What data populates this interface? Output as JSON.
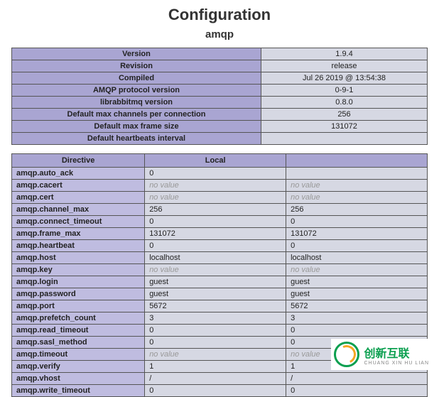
{
  "header": {
    "title": "Configuration",
    "subtitle": "amqp"
  },
  "info": [
    {
      "label": "Version",
      "value": "1.9.4"
    },
    {
      "label": "Revision",
      "value": "release"
    },
    {
      "label": "Compiled",
      "value": "Jul 26 2019 @ 13:54:38"
    },
    {
      "label": "AMQP protocol version",
      "value": "0-9-1"
    },
    {
      "label": "librabbitmq version",
      "value": "0.8.0"
    },
    {
      "label": "Default max channels per connection",
      "value": "256"
    },
    {
      "label": "Default max frame size",
      "value": "131072"
    },
    {
      "label": "Default heartbeats interval",
      "value": ""
    }
  ],
  "dir_headers": {
    "directive": "Directive",
    "local": "Local",
    "master": ""
  },
  "directives": [
    {
      "name": "amqp.auto_ack",
      "local": "0",
      "master": ""
    },
    {
      "name": "amqp.cacert",
      "local": "no value",
      "master": "no value"
    },
    {
      "name": "amqp.cert",
      "local": "no value",
      "master": "no value"
    },
    {
      "name": "amqp.channel_max",
      "local": "256",
      "master": "256"
    },
    {
      "name": "amqp.connect_timeout",
      "local": "0",
      "master": "0"
    },
    {
      "name": "amqp.frame_max",
      "local": "131072",
      "master": "131072"
    },
    {
      "name": "amqp.heartbeat",
      "local": "0",
      "master": "0"
    },
    {
      "name": "amqp.host",
      "local": "localhost",
      "master": "localhost"
    },
    {
      "name": "amqp.key",
      "local": "no value",
      "master": "no value"
    },
    {
      "name": "amqp.login",
      "local": "guest",
      "master": "guest"
    },
    {
      "name": "amqp.password",
      "local": "guest",
      "master": "guest"
    },
    {
      "name": "amqp.port",
      "local": "5672",
      "master": "5672"
    },
    {
      "name": "amqp.prefetch_count",
      "local": "3",
      "master": "3"
    },
    {
      "name": "amqp.read_timeout",
      "local": "0",
      "master": "0"
    },
    {
      "name": "amqp.sasl_method",
      "local": "0",
      "master": "0"
    },
    {
      "name": "amqp.timeout",
      "local": "no value",
      "master": "no value"
    },
    {
      "name": "amqp.verify",
      "local": "1",
      "master": "1"
    },
    {
      "name": "amqp.vhost",
      "local": "/",
      "master": "/"
    },
    {
      "name": "amqp.write_timeout",
      "local": "0",
      "master": "0"
    }
  ],
  "watermark": {
    "brand": "创新互联",
    "sub": "CHUANG XIN HU LIAN"
  }
}
